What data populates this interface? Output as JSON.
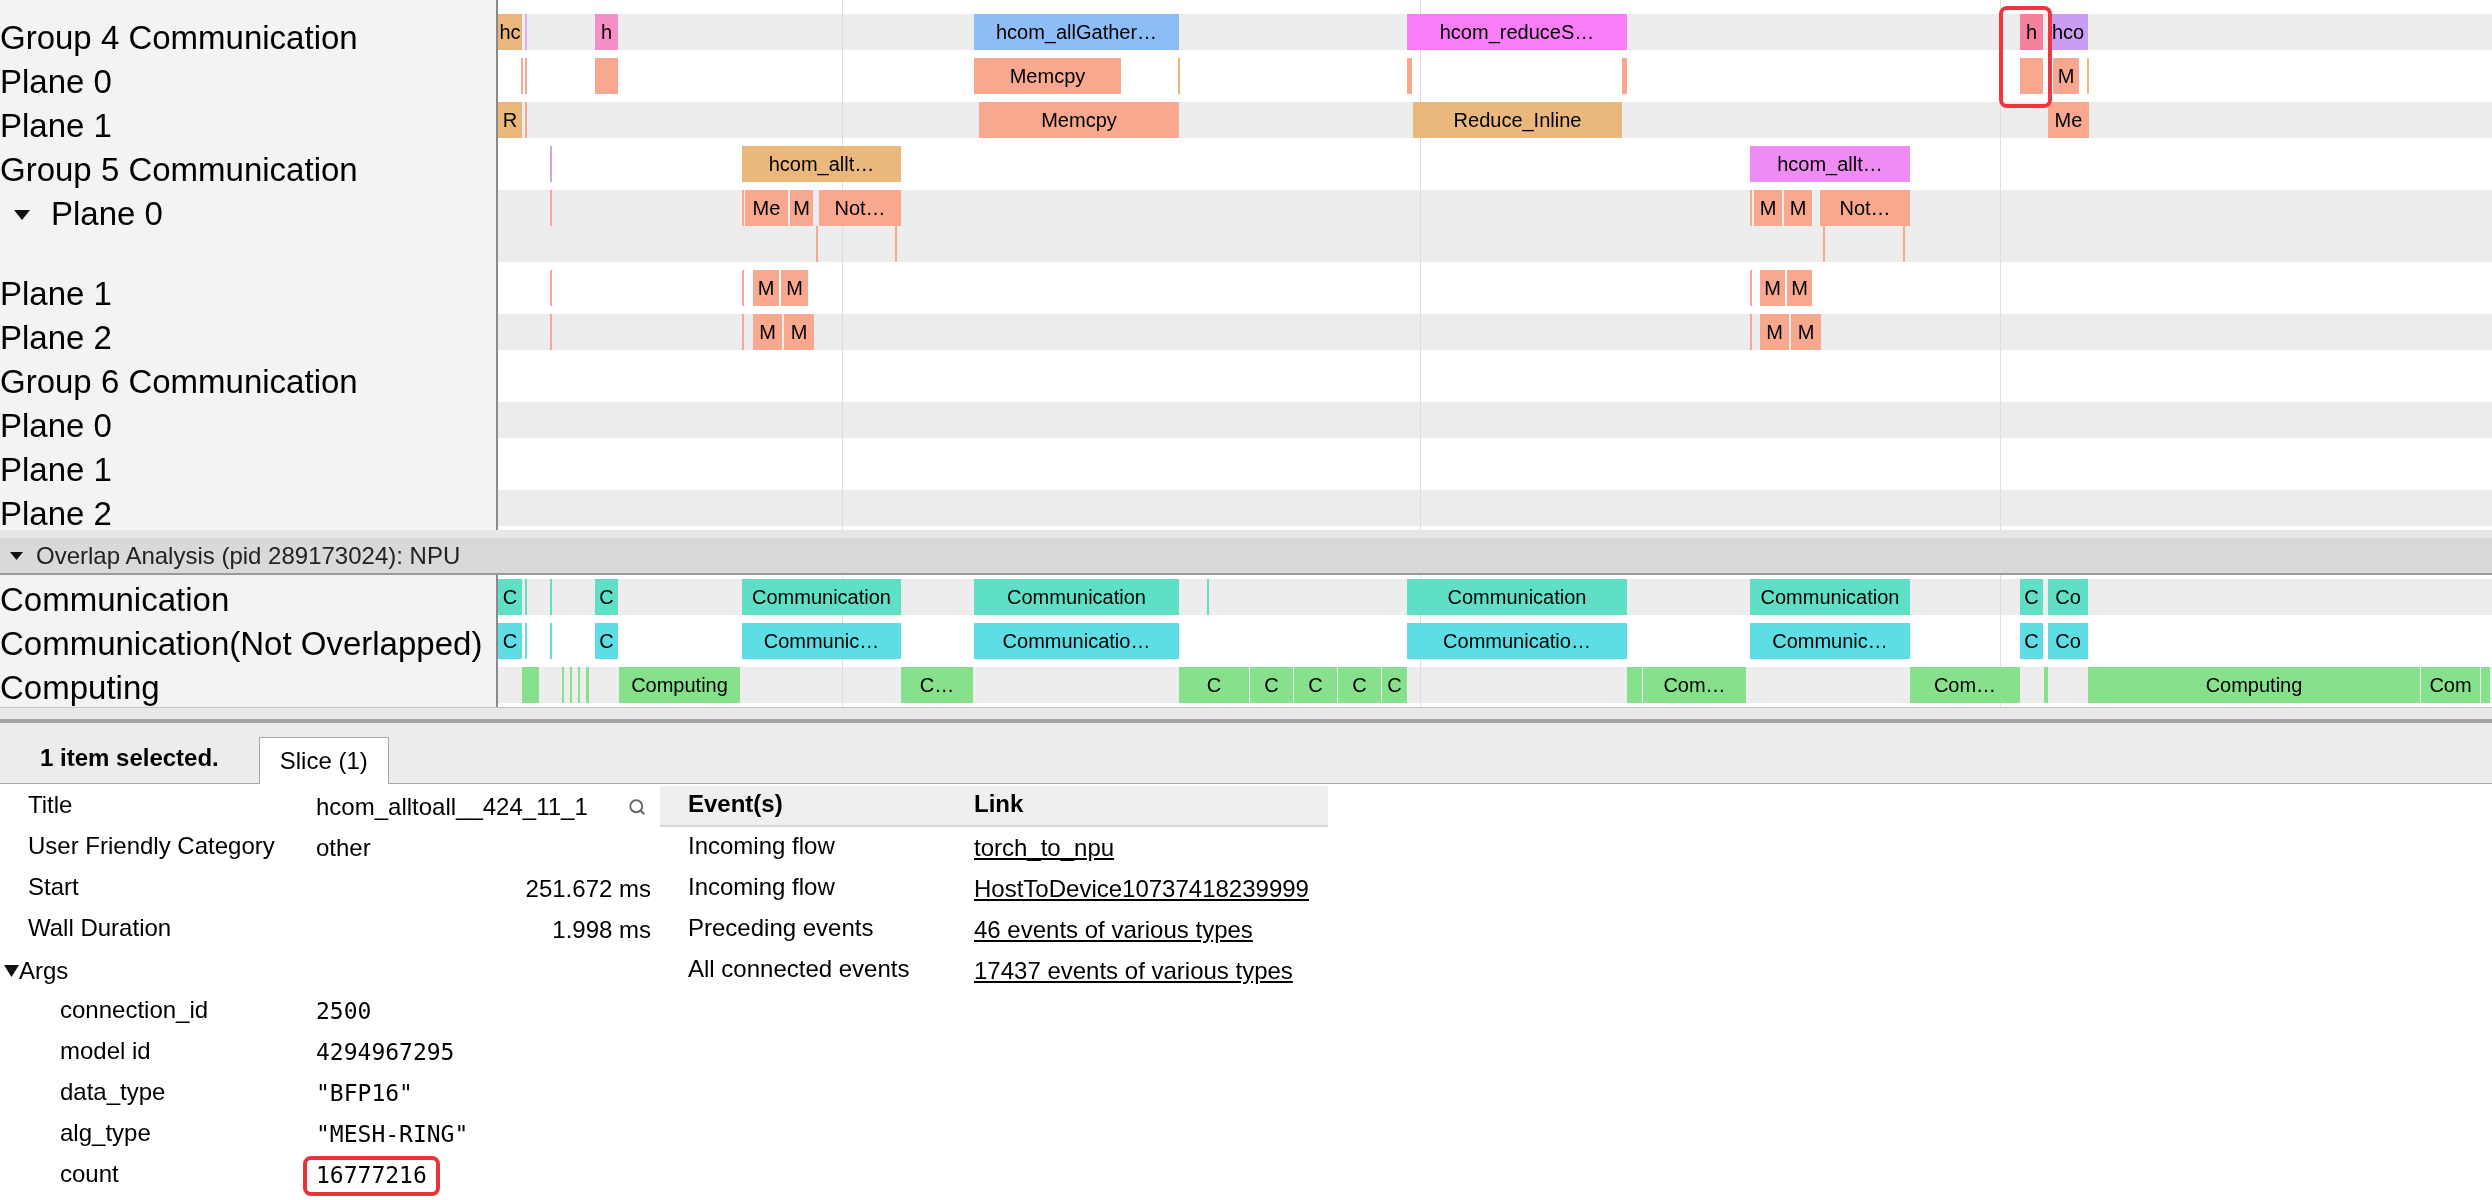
{
  "tracks": [
    {
      "label": "Group 4 Communication",
      "slices": [
        {
          "label": "hc",
          "color": "#eab87c",
          "highlighted": false
        },
        {
          "color": "#e6a8e8",
          "highlighted": false
        },
        {
          "label": "h",
          "color": "#f68fc5",
          "highlighted": false
        },
        {
          "label": "hcom_allGather…",
          "color": "#8dbdf6",
          "highlighted": false
        },
        {
          "label": "hcom_reduceS…",
          "color": "#f97df6",
          "highlighted": false
        },
        {
          "label": "h",
          "color": "#f3809c",
          "highlighted": true
        },
        {
          "label": "hco",
          "color": "#c89df2",
          "highlighted": false
        }
      ]
    },
    {
      "label": "Plane 0",
      "slices": [
        {
          "color": "#f8a88e"
        },
        {
          "color": "#f8a88e"
        },
        {
          "color": "#f8a88e"
        },
        {
          "label": "Memcpy",
          "color": "#f8a88e"
        },
        {
          "color": "#eab87c"
        },
        {
          "color": "#f8a88e"
        },
        {
          "color": "#f8a88e"
        },
        {
          "color": "#f8a88e"
        },
        {
          "label": "M",
          "color": "#f8a88e"
        },
        {
          "color": "#eab87c"
        }
      ]
    },
    {
      "label": "Plane 1",
      "slices": [
        {
          "label": "R",
          "color": "#eab87c"
        },
        {
          "color": "#f8a88e"
        },
        {
          "label": "Memcpy",
          "color": "#f8a88e"
        },
        {
          "label": "Reduce_Inline",
          "color": "#eab87c"
        },
        {
          "label": "Me",
          "color": "#f8a88e"
        }
      ]
    },
    {
      "label": "Group 5 Communication",
      "slices": [
        {
          "color": "#c6a6f0"
        },
        {
          "label": "hcom_allt…",
          "color": "#eab87c"
        },
        {
          "label": "hcom_allt…",
          "color": "#ef8cf3"
        }
      ]
    },
    {
      "label": "Plane 0",
      "expanded": true,
      "levels": [
        [
          {
            "color": "#f8a88e"
          },
          {
            "color": "#f8a88e"
          },
          {
            "label": "Me",
            "color": "#f8a88e"
          },
          {
            "label": "M",
            "color": "#f8a88e"
          },
          {
            "label": "Not…",
            "color": "#f8a88e"
          },
          {
            "color": "#f8a88e"
          },
          {
            "label": "M",
            "color": "#f8a88e"
          },
          {
            "label": "M",
            "color": "#f8a88e"
          },
          {
            "label": "Not…",
            "color": "#f8a88e"
          }
        ],
        [
          {
            "color": "#f8a88e"
          },
          {
            "color": "#f8a88e"
          },
          {
            "color": "#f8a88e"
          },
          {
            "color": "#f8a88e"
          }
        ]
      ]
    },
    {
      "label": "Plane 1",
      "slices": [
        {
          "color": "#f8a88e"
        },
        {
          "color": "#f8a88e"
        },
        {
          "label": "M",
          "color": "#f8a88e"
        },
        {
          "label": "M",
          "color": "#f8a88e"
        },
        {
          "color": "#f8a88e"
        },
        {
          "label": "M",
          "color": "#f8a88e"
        },
        {
          "label": "M",
          "color": "#f8a88e"
        }
      ]
    },
    {
      "label": "Plane 2",
      "slices": [
        {
          "color": "#f8a88e"
        },
        {
          "color": "#f8a88e"
        },
        {
          "label": "M",
          "color": "#f8a88e"
        },
        {
          "label": "M",
          "color": "#f8a88e"
        },
        {
          "color": "#f8a88e"
        },
        {
          "label": "M",
          "color": "#f8a88e"
        },
        {
          "label": "M",
          "color": "#f8a88e"
        }
      ]
    },
    {
      "label": "Group 6 Communication"
    },
    {
      "label": "Plane 0"
    },
    {
      "label": "Plane 1"
    },
    {
      "label": "Plane 2"
    }
  ],
  "overlap_analysis": {
    "title": "Overlap Analysis (pid 289173024): NPU",
    "expanded": true,
    "tracks": [
      {
        "label": "Communication",
        "slices": [
          {
            "label": "C",
            "color": "#5fe0c6"
          },
          {
            "color": "#5fe0c6"
          },
          {
            "color": "#5fe0c6"
          },
          {
            "label": "C",
            "color": "#5fe0c6"
          },
          {
            "label": "Communication",
            "color": "#5fe0c6"
          },
          {
            "label": "Communication",
            "color": "#5fe0c6"
          },
          {
            "color": "#5fe0c6"
          },
          {
            "label": "Communication",
            "color": "#5fe0c6"
          },
          {
            "label": "Communication",
            "color": "#5fe0c6"
          },
          {
            "label": "C",
            "color": "#5fe0c6"
          },
          {
            "label": "Co",
            "color": "#5fe0c6"
          }
        ]
      },
      {
        "label": "Communication(Not Overlapped)",
        "slices": [
          {
            "label": "C",
            "color": "#5edde5"
          },
          {
            "color": "#5edde5"
          },
          {
            "color": "#5edde5"
          },
          {
            "label": "C",
            "color": "#5edde5"
          },
          {
            "label": "Communic…",
            "color": "#5edde5"
          },
          {
            "label": "Communicatio…",
            "color": "#5edde5"
          },
          {
            "label": "Communicatio…",
            "color": "#5edde5"
          },
          {
            "label": "Communic…",
            "color": "#5edde5"
          },
          {
            "label": "C",
            "color": "#5edde5"
          },
          {
            "label": "Co",
            "color": "#5edde5"
          }
        ]
      },
      {
        "label": "Computing",
        "slices": [
          {
            "color": "#87e08c"
          },
          {
            "color": "#87e08c"
          },
          {
            "color": "#87e08c"
          },
          {
            "color": "#87e08c"
          },
          {
            "color": "#87e08c"
          },
          {
            "label": "Computing",
            "color": "#87e08c"
          },
          {
            "label": "C…",
            "color": "#87e08c"
          },
          {
            "label": "C",
            "color": "#87e08c"
          },
          {
            "label": "C",
            "color": "#87e08c"
          },
          {
            "label": "C",
            "color": "#87e08c"
          },
          {
            "label": "C",
            "color": "#87e08c"
          },
          {
            "label": "C",
            "color": "#87e08c"
          },
          {
            "color": "#87e08c"
          },
          {
            "label": "Com…",
            "color": "#87e08c"
          },
          {
            "label": "Com…",
            "color": "#87e08c"
          },
          {
            "color": "#87e08c"
          },
          {
            "label": "Computing",
            "color": "#87e08c"
          },
          {
            "label": "Com",
            "color": "#87e08c"
          },
          {
            "color": "#87e08c"
          }
        ]
      }
    ]
  },
  "details": {
    "status": "1 item selected.",
    "tabs": [
      {
        "label": "Slice (1)",
        "selected": true
      }
    ],
    "fields": [
      {
        "kind": "search",
        "name": "Title",
        "value": "hcom_alltoall__424_11_1"
      },
      {
        "kind": "text",
        "name": "User Friendly Category",
        "value": "other"
      },
      {
        "kind": "number",
        "name": "Start",
        "value": "251.672 ms"
      },
      {
        "kind": "number",
        "name": "Wall Duration",
        "value": "1.998 ms"
      }
    ],
    "args": {
      "label": "Args",
      "expanded": true,
      "items": [
        {
          "name": "connection_id",
          "value": "2500",
          "highlighted": false
        },
        {
          "name": "model id",
          "value": "4294967295",
          "highlighted": false
        },
        {
          "name": "data_type",
          "value": "\"BFP16\"",
          "highlighted": false
        },
        {
          "name": "alg_type",
          "value": "\"MESH-RING\"",
          "highlighted": false
        },
        {
          "name": "count",
          "value": "16777216",
          "highlighted": true
        }
      ]
    },
    "events": {
      "columns": [
        "Event(s)",
        "Link"
      ],
      "rows": [
        {
          "event": "Incoming flow",
          "link": "torch_to_npu"
        },
        {
          "event": "Incoming flow",
          "link": "HostToDevice10737418239999"
        },
        {
          "event": "Preceding events",
          "link": "46 events of various types"
        },
        {
          "event": "All connected events",
          "link": "17437 events of various types"
        }
      ]
    }
  }
}
